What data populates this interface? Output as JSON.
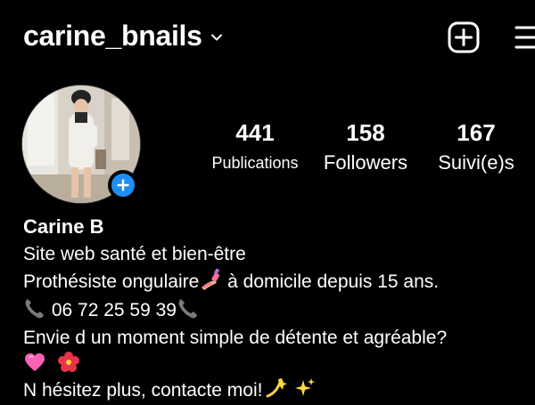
{
  "header": {
    "username": "carine_bnails",
    "switcher_icon": "chevron-down-icon",
    "create_icon": "plus-square-icon",
    "menu_icon": "hamburger-menu-icon"
  },
  "profile": {
    "avatar_alt": "profile photo",
    "add_story_icon": "plus-icon",
    "accent_color": "#1f8df5"
  },
  "stats": {
    "posts": {
      "value": "441",
      "label": "Publications"
    },
    "followers": {
      "value": "158",
      "label": "Followers"
    },
    "following": {
      "value": "167",
      "label": "Suivi(e)s"
    }
  },
  "bio": {
    "name": "Carine B",
    "category": "Site web santé et bien-être",
    "line1_a": "Prothésiste ongulaire",
    "line1_emoji": "nail-polish-emoji",
    "line1_b": " à domicile depuis 15 ans.",
    "phone_emoji": "telephone-receiver-emoji",
    "phone": " 06 72 25 59 39",
    "line3": "Envie d un moment simple de détente et agréable?",
    "line4_emojis": [
      "pink-heart-emoji",
      "hibiscus-emoji"
    ],
    "line5": "N hésitez plus, contacte moi!",
    "line5_emojis": [
      "dizzy-emoji",
      "sparkles-emoji"
    ]
  }
}
